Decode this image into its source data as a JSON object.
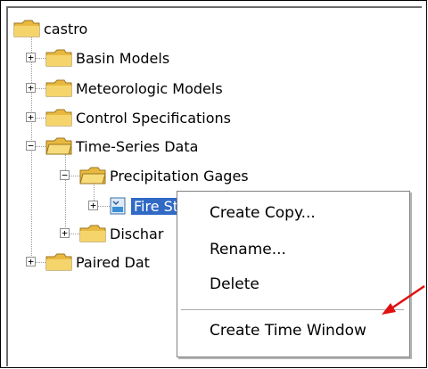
{
  "tree": {
    "root": "castro",
    "items": [
      {
        "label": "Basin Models",
        "toggle": "+"
      },
      {
        "label": "Meteorologic Models",
        "toggle": "+"
      },
      {
        "label": "Control Specifications",
        "toggle": "+"
      },
      {
        "label": "Time-Series Data",
        "toggle": "−"
      },
      {
        "label": "Precipitation Gages",
        "toggle": "−"
      },
      {
        "label": "Fire Stati",
        "toggle": "+"
      },
      {
        "label": "Dischar",
        "toggle": "+"
      },
      {
        "label": "Paired Dat",
        "toggle": "+"
      }
    ]
  },
  "context_menu": {
    "items": [
      "Create Copy...",
      "Rename...",
      "Delete",
      "Create Time Window"
    ]
  },
  "colors": {
    "folder": "#f5d56b",
    "selection": "#316ac5",
    "arrow": "#e01010"
  }
}
